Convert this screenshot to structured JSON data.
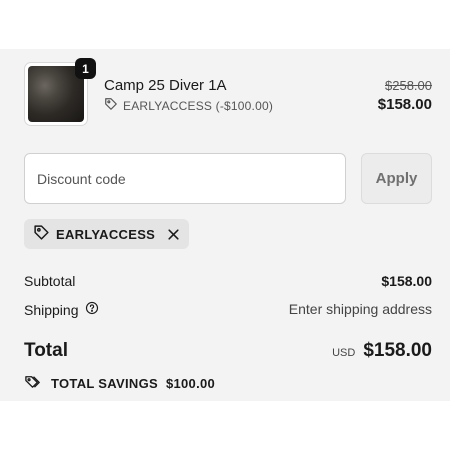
{
  "line_item": {
    "quantity": "1",
    "name": "Camp 25 Diver 1A",
    "discount_text": "EARLYACCESS (-$100.00)",
    "original_price": "$258.00",
    "price": "$158.00",
    "thumbnail_icon": "product-image"
  },
  "discount": {
    "placeholder": "Discount code",
    "value": "",
    "apply_label": "Apply",
    "applied_code": "EARLYACCESS"
  },
  "summary": {
    "subtotal_label": "Subtotal",
    "subtotal_value": "$158.00",
    "shipping_label": "Shipping",
    "shipping_value": "Enter shipping address",
    "total_label": "Total",
    "currency": "USD",
    "total_value": "$158.00",
    "savings_label": "TOTAL SAVINGS",
    "savings_value": "$100.00"
  },
  "icons": {
    "tag": "tag-icon",
    "close": "close-icon",
    "help": "help-circle-icon",
    "savings": "tags-icon"
  },
  "colors": {
    "panel_bg": "#f3f3f3",
    "text": "#1a1a1a",
    "chip_bg": "#e4e4e4",
    "badge_bg": "#111111"
  }
}
